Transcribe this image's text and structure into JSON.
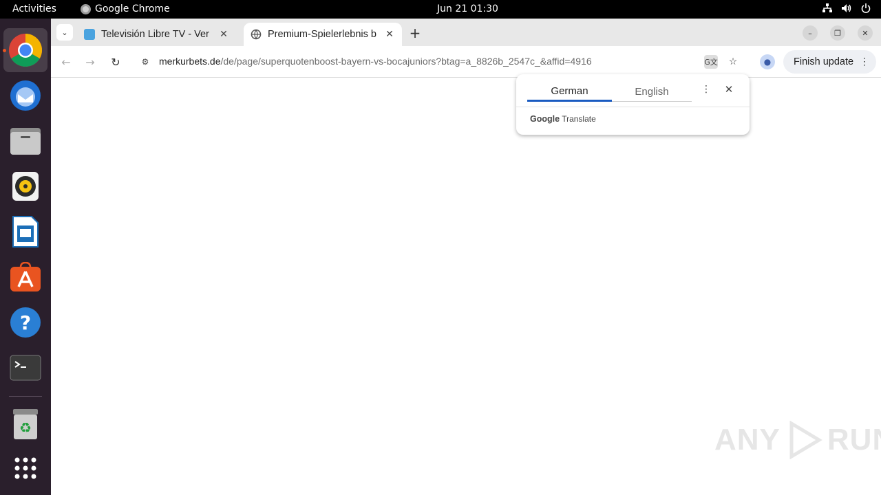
{
  "topbar": {
    "activities": "Activities",
    "app_name": "Google Chrome",
    "clock": "Jun 21  01:30",
    "tray_icons": [
      "network-icon",
      "volume-icon",
      "power-icon"
    ]
  },
  "dock": {
    "apps": [
      "chrome",
      "thunderbird",
      "files",
      "rhythmbox",
      "libreoffice-writer",
      "app-center",
      "help",
      "terminal",
      "trash",
      "show-apps"
    ]
  },
  "browser": {
    "tabs": [
      {
        "title": "Televisión Libre TV - Ver",
        "active": false
      },
      {
        "title": "Premium-Spielerlebnis b",
        "active": true
      }
    ],
    "address": {
      "host": "merkurbets.de",
      "path": "/de/page/superquotenboost-bayern-vs-bocajuniors?btag=a_8826b_2547c_&affid=4916"
    },
    "update_button": "Finish update"
  },
  "translate_popup": {
    "source_lang": "German",
    "target_lang": "English",
    "brand_google": "Google",
    "brand_translate": "Translate"
  },
  "watermark": {
    "left": "ANY",
    "right": "RUN"
  },
  "colors": {
    "accent": "#1a5bc1",
    "dock_bg": "#2a1f2c",
    "running_indicator": "#e95420"
  }
}
